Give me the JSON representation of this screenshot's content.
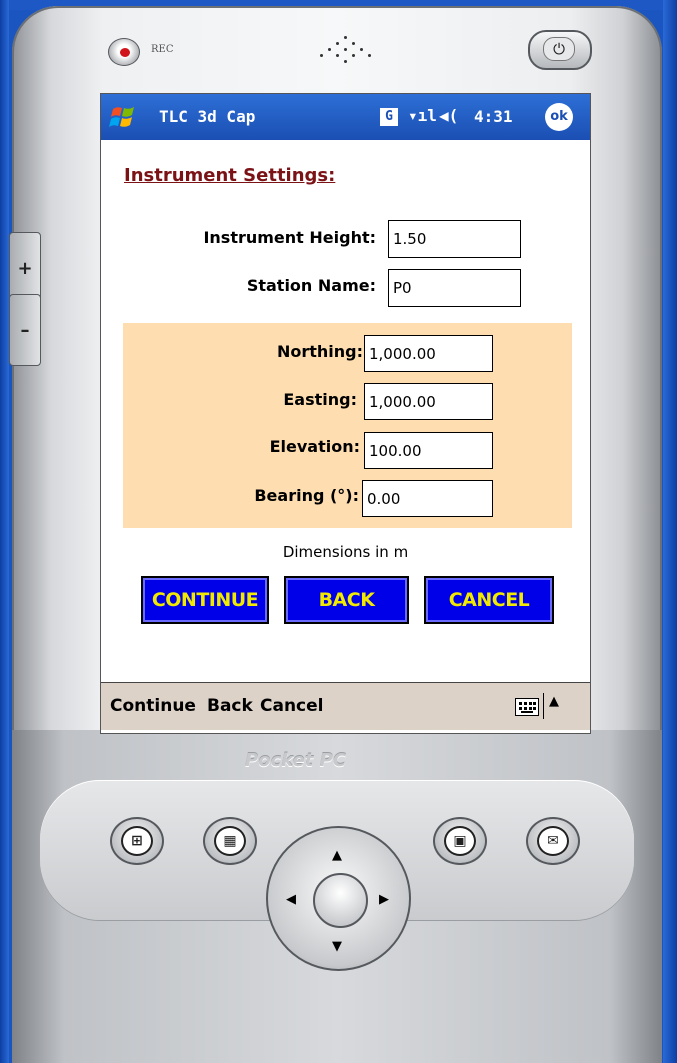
{
  "titlebar": {
    "app_title": "TLC 3d Cap",
    "network_badge": "G",
    "signal_icon": "signal-bars-icon",
    "volume_icon": "speaker-icon",
    "time": "4:31",
    "ok_label": "ok"
  },
  "device": {
    "rec_label": "REC",
    "brand": "Pocket PC",
    "side_plus": "+",
    "side_minus": "–"
  },
  "form": {
    "heading": "Instrument Settings:",
    "instrument_height_label": "Instrument Height:",
    "instrument_height_value": "1.50",
    "station_name_label": "Station Name:",
    "station_name_value": "P0",
    "northing_label": "Northing:",
    "northing_value": "1,000.00",
    "easting_label": "Easting:",
    "easting_value": "1,000.00",
    "elevation_label": "Elevation:",
    "elevation_value": "100.00",
    "bearing_label": "Bearing (°):",
    "bearing_value": "0.00",
    "dimensions_note": "Dimensions in m"
  },
  "buttons": {
    "continue": "CONTINUE",
    "back": "BACK",
    "cancel": "CANCEL"
  },
  "menubar": {
    "continue": "Continue",
    "back": "Back",
    "cancel": "Cancel",
    "input_icon": "keyboard-icon",
    "arrow": "▲"
  },
  "colors": {
    "title_bar": "#1b4fb3",
    "heading": "#7a1216",
    "panel": "#fedeb0",
    "button_bg": "#0000e8",
    "button_text": "#f2e900",
    "menubar": "#dcd2c8"
  }
}
